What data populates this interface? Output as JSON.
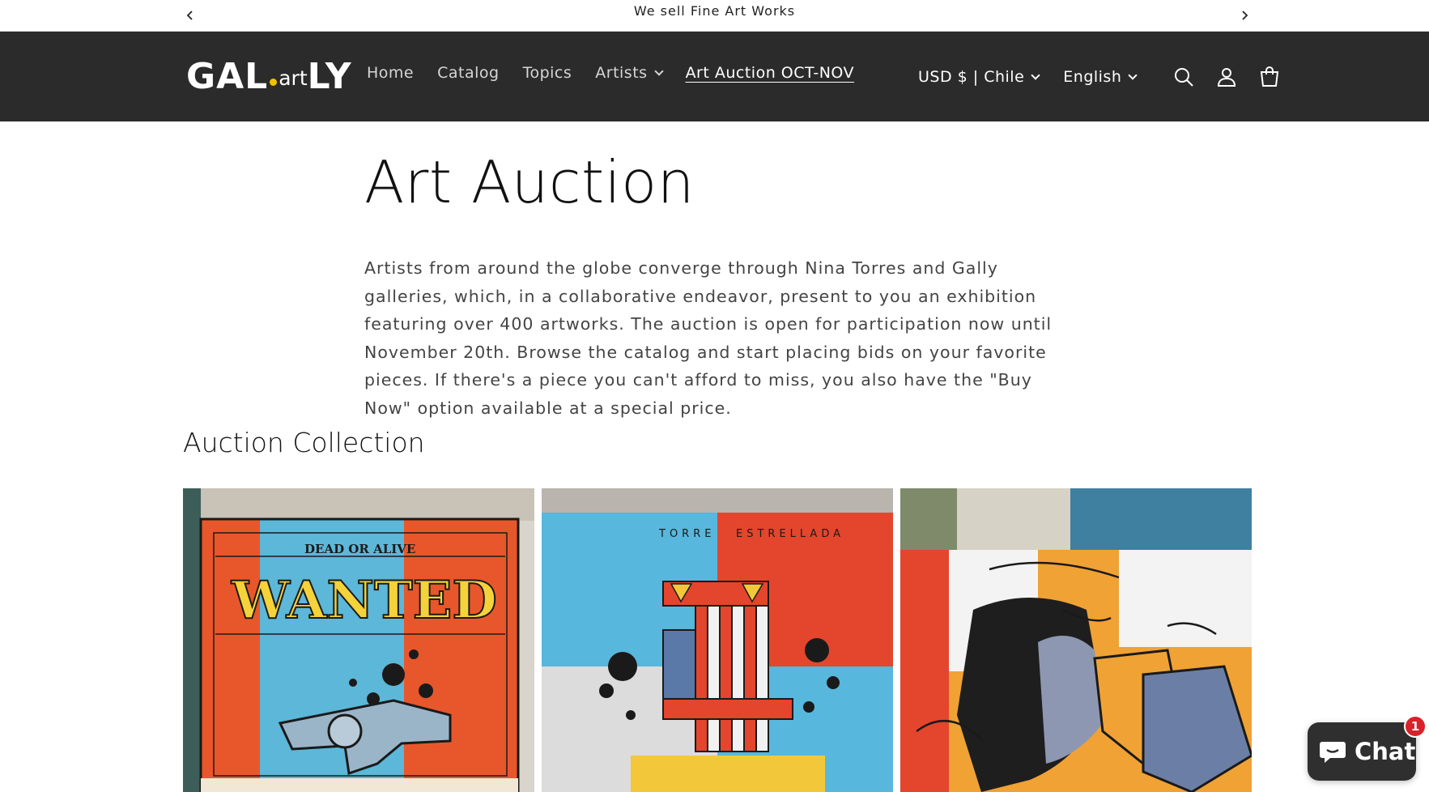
{
  "announcement": {
    "message": "We sell Fine Art Works",
    "prev_icon": "chevron-left-icon",
    "next_icon": "chevron-right-icon"
  },
  "header": {
    "logo": {
      "main": "GAL",
      "art": "art",
      "tail": "LY",
      "accent_color": "#f2c200"
    },
    "nav": [
      {
        "label": "Home"
      },
      {
        "label": "Catalog"
      },
      {
        "label": "Topics"
      },
      {
        "label": "Artists"
      },
      {
        "label": "Art Auction OCT-NOV"
      }
    ],
    "currency": "USD $ | Chile",
    "language": "English",
    "icons": [
      "search-icon",
      "account-icon",
      "cart-icon"
    ],
    "background": "#2b2b2b"
  },
  "main": {
    "title": "Art Auction",
    "intro": "Artists from around the globe converge through Nina Torres and Gally galleries, which, in a collaborative endeavor, present to you an exhibition featuring over 400 artworks. The auction is open for participation now until November 20th. Browse the catalog and start placing bids on your favorite pieces. If there's a piece you can't afford to miss, you also have the \"Buy Now\" option available at a special price.",
    "section_title": "Auction Collection",
    "cards": [
      {
        "art_text_1": "DEAD OR ALIVE",
        "art_text_2": "WANTED"
      },
      {
        "art_text_1": "TORRE",
        "art_text_2": "ESTRELLADA"
      },
      {}
    ]
  },
  "chat": {
    "label": "Chat",
    "badge": "1",
    "icon": "chat-bubble-icon"
  }
}
